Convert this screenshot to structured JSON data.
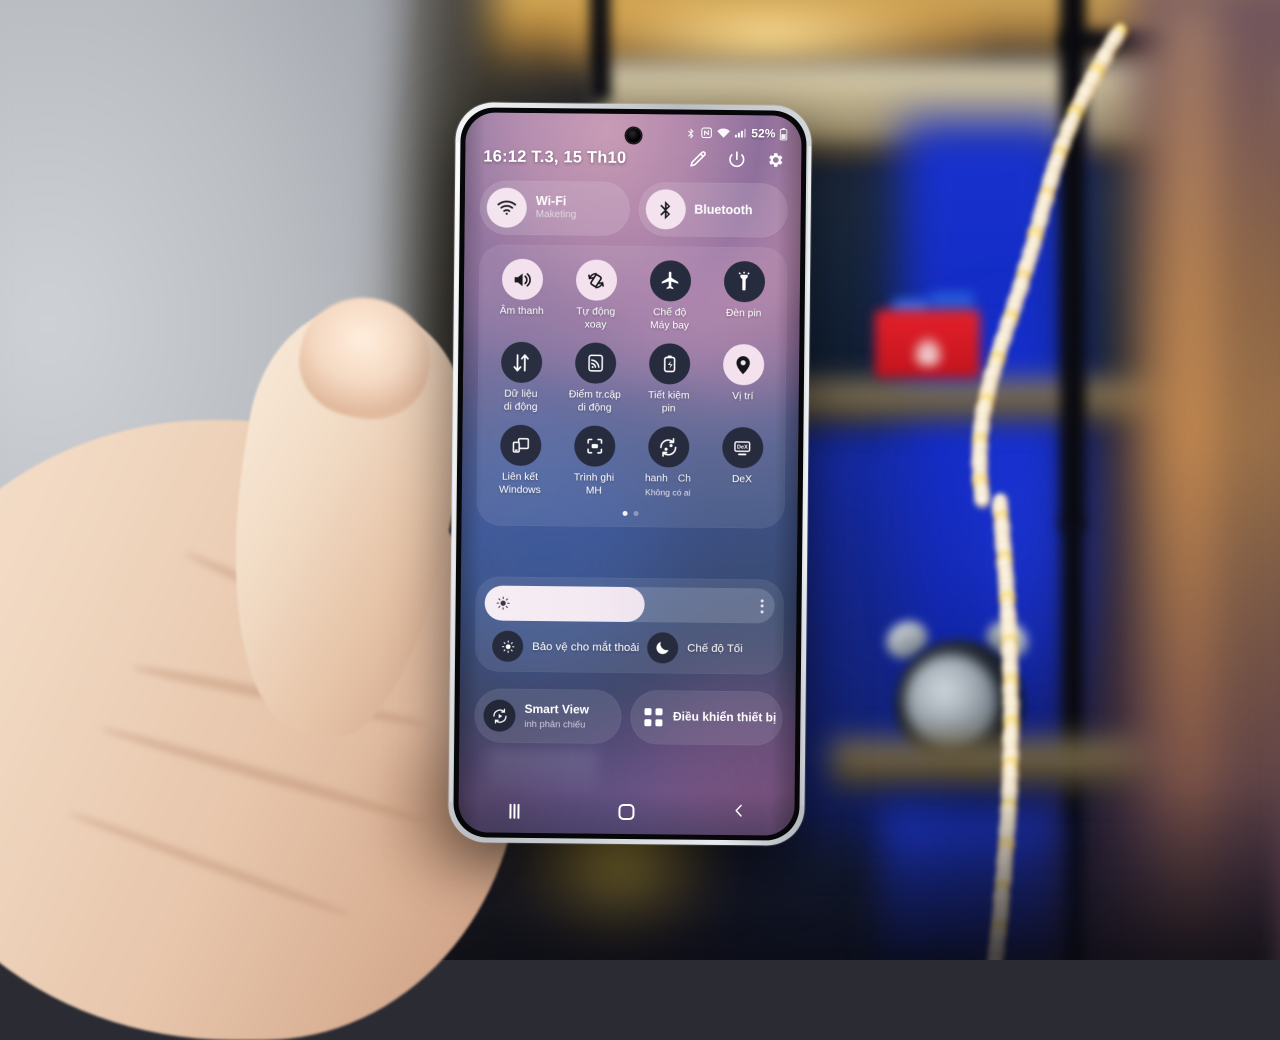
{
  "status_bar": {
    "icons": [
      "bluetooth-icon",
      "nfc-icon",
      "wifi-icon",
      "signal-icon"
    ],
    "battery_percent": "52%",
    "battery_icon": "battery-icon"
  },
  "header": {
    "clock": "16:12  T.3, 15 Th10",
    "actions": [
      {
        "name": "edit-icon",
        "label": "Edit"
      },
      {
        "name": "power-icon",
        "label": "Power"
      },
      {
        "name": "settings-icon",
        "label": "Settings"
      }
    ]
  },
  "connectivity_pills": [
    {
      "icon": "wifi-icon",
      "title": "Wi-Fi",
      "subtitle": "Maketing",
      "state": "on"
    },
    {
      "icon": "bluetooth-icon",
      "title": "Bluetooth",
      "subtitle": "",
      "state": "on"
    }
  ],
  "tiles": {
    "rows": [
      [
        {
          "icon": "sound-icon",
          "label": "Âm thanh",
          "sub": "",
          "state": "on"
        },
        {
          "icon": "auto-rotate-icon",
          "label": "Tự động\nxoay",
          "sub": "",
          "state": "on"
        },
        {
          "icon": "airplane-icon",
          "label": "Chế độ\nMáy bay",
          "sub": "",
          "state": "off"
        },
        {
          "icon": "flashlight-icon",
          "label": "Đèn pin",
          "sub": "",
          "state": "off"
        }
      ],
      [
        {
          "icon": "mobile-data-icon",
          "label": "Dữ liệu\ndi động",
          "sub": "",
          "state": "off"
        },
        {
          "icon": "hotspot-icon",
          "label": "Điểm tr.cập\ndi động",
          "sub": "",
          "state": "off"
        },
        {
          "icon": "battery-saver-icon",
          "label": "Tiết kiệm\npin",
          "sub": "",
          "state": "off"
        },
        {
          "icon": "location-icon",
          "label": "Vị trí",
          "sub": "",
          "state": "on"
        }
      ],
      [
        {
          "icon": "link-to-windows-icon",
          "label": "Liên kết\nWindows",
          "sub": "",
          "state": "off"
        },
        {
          "icon": "screen-recorder-icon",
          "label": "Trình ghi\nMH",
          "sub": "",
          "state": "off"
        },
        {
          "icon": "nearby-share-icon",
          "label": "hanh",
          "label_ghost": "Ch",
          "sub": "Không có ai",
          "state": "off"
        },
        {
          "icon": "dex-icon",
          "label": "DeX",
          "sub": "",
          "state": "off"
        }
      ]
    ],
    "pagination": {
      "count": 2,
      "active_index": 0
    }
  },
  "brightness": {
    "slider_icon": "brightness-icon",
    "value_percent": 55,
    "menu_icon": "more-options-icon",
    "actions": [
      {
        "icon": "eye-comfort-icon",
        "label": "Bảo vệ cho mắt thoải"
      },
      {
        "icon": "dark-mode-icon",
        "label": "Chế độ Tối"
      }
    ]
  },
  "bottom_pills": [
    {
      "icon": "smart-view-icon",
      "title": "Smart View",
      "subtitle": "inh phản chiếu"
    },
    {
      "icon": "device-control-icon",
      "title": "Điều khiển thiết bị",
      "subtitle": ""
    }
  ],
  "navigation": [
    {
      "name": "recents-button",
      "label": "Recents"
    },
    {
      "name": "home-button",
      "label": "Home"
    },
    {
      "name": "back-button",
      "label": "Back"
    }
  ],
  "colors": {
    "tile_active_bg": "#f3e2ee",
    "tile_inactive_bg": "#262b3d",
    "text_primary": "#ffffff",
    "panel_bg": "rgba(255,255,255,0.085)"
  }
}
